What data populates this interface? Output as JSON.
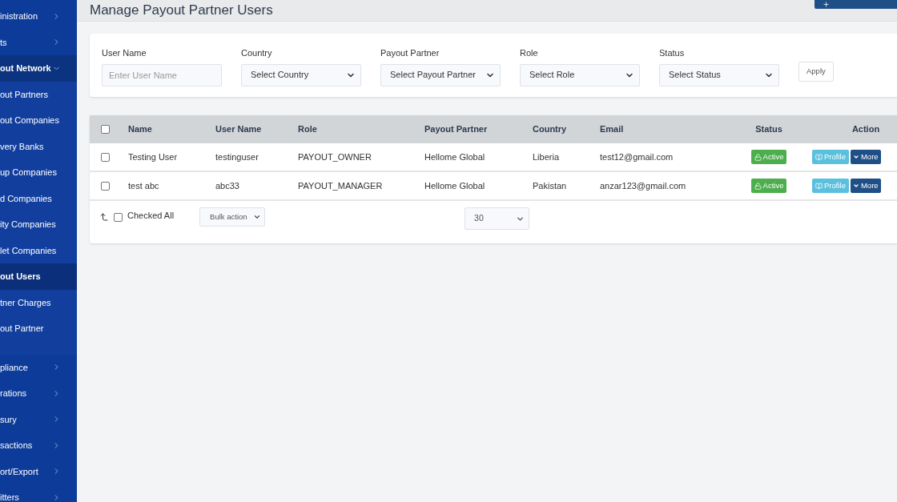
{
  "sidebar": {
    "items": [
      {
        "label": "inistration",
        "kind": "group",
        "expanded": false
      },
      {
        "label": "ts",
        "kind": "group",
        "expanded": false
      },
      {
        "label": "out Network",
        "kind": "group",
        "expanded": true,
        "children": [
          {
            "label": "out Partners",
            "selected": false
          },
          {
            "label": "out Companies",
            "selected": false
          },
          {
            "label": "very Banks",
            "selected": false
          },
          {
            "label": "up Companies",
            "selected": false
          },
          {
            "label": "d Companies",
            "selected": false
          },
          {
            "label": "ity Companies",
            "selected": false
          },
          {
            "label": "let Companies",
            "selected": false
          },
          {
            "label": "out Users",
            "selected": true
          },
          {
            "label": "tner Charges",
            "selected": false
          },
          {
            "label": "out Partner",
            "selected": false
          }
        ]
      },
      {
        "label": "pliance",
        "kind": "group",
        "expanded": false
      },
      {
        "label": "rations",
        "kind": "group",
        "expanded": false
      },
      {
        "label": "sury",
        "kind": "group",
        "expanded": false
      },
      {
        "label": "sactions",
        "kind": "group",
        "expanded": false
      },
      {
        "label": "ort/Export",
        "kind": "group",
        "expanded": false
      },
      {
        "label": "itters",
        "kind": "group",
        "expanded": false
      }
    ]
  },
  "page": {
    "title": "Manage Payout Partner Users"
  },
  "filters": [
    {
      "label": "User Name",
      "kind": "input",
      "placeholder": "Enter User Name"
    },
    {
      "label": "Country",
      "kind": "select",
      "value": "Select Country"
    },
    {
      "label": "Payout Partner",
      "kind": "select",
      "value": "Select Payout Partner"
    },
    {
      "label": "Role",
      "kind": "select",
      "value": "Select Role"
    },
    {
      "label": "Status",
      "kind": "select",
      "value": "Select Status"
    }
  ],
  "apply_button": "Apply",
  "table": {
    "header_checked": false,
    "columns": [
      "Name",
      "User Name",
      "Role",
      "Payout Partner",
      "Country",
      "Email",
      "Status",
      "Action"
    ],
    "rows": [
      {
        "checked": false,
        "name": "Testing User",
        "user_name": "testinguser",
        "role": "PAYOUT_OWNER",
        "payout_partner": "Hellome Global",
        "country": "Liberia",
        "email": "test12@gmail.com",
        "status": "Active",
        "actions": [
          "Profile",
          "More"
        ]
      },
      {
        "checked": false,
        "name": "test abc",
        "user_name": "abc33",
        "role": "PAYOUT_MANAGER",
        "payout_partner": "Hellome Global",
        "country": "Pakistan",
        "email": "anzar123@gmail.com",
        "status": "Active",
        "actions": [
          "Profile",
          "More"
        ]
      }
    ]
  },
  "footer": {
    "checked_all": false,
    "checked_all_label": "Checked All",
    "bulk_action": "Bulk action",
    "page_size": "30"
  }
}
